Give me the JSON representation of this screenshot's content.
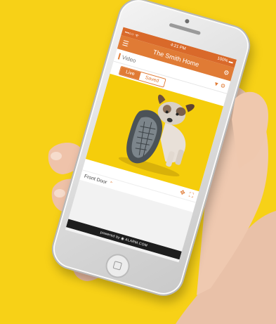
{
  "phone": {
    "status": {
      "carrier": "•••○○ ᯤ",
      "time": "4:21 PM",
      "battery": "100% ▬"
    },
    "header": {
      "title": "The Smith Home"
    },
    "video_section": {
      "label": "Video"
    },
    "tabs": {
      "live": "Live",
      "saved": "Saved"
    },
    "camera": {
      "name": "Front Door"
    },
    "footer": {
      "powered_by": "powered by ◉ ALARM.COM"
    }
  },
  "colors": {
    "background": "#f7d117",
    "accent": "#e07b35",
    "video_bg": "#f5cd0b"
  },
  "icons": [
    "menu-icon",
    "settings-icon",
    "filter-icon",
    "gear-icon",
    "pan-icon",
    "fullscreen-icon",
    "chevron-up-icon",
    "alarm-logo-icon"
  ]
}
